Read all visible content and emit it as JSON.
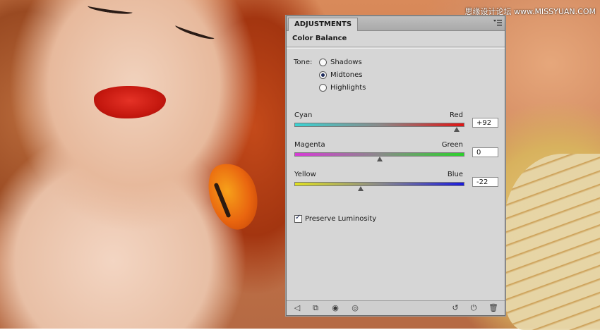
{
  "watermark": "思缘设计论坛 www.MISSYUAN.COM",
  "panel": {
    "tab_label": "ADJUSTMENTS",
    "heading": "Color Balance",
    "tone": {
      "label": "Tone:",
      "options": [
        {
          "label": "Shadows",
          "selected": false
        },
        {
          "label": "Midtones",
          "selected": true
        },
        {
          "label": "Highlights",
          "selected": false
        }
      ]
    },
    "sliders": [
      {
        "left_label": "Cyan",
        "right_label": "Red",
        "value": "+92",
        "numeric": 92,
        "track_colors": [
          "#3ad3d3",
          "#e01414"
        ]
      },
      {
        "left_label": "Magenta",
        "right_label": "Green",
        "value": "0",
        "numeric": 0,
        "track_colors": [
          "#d63ad6",
          "#2bd12b"
        ]
      },
      {
        "left_label": "Yellow",
        "right_label": "Blue",
        "value": "-22",
        "numeric": -22,
        "track_colors": [
          "#e0e020",
          "#1b1bdc"
        ]
      }
    ],
    "slider_range": [
      -100,
      100
    ],
    "preserve_luminosity": {
      "label": "Preserve Luminosity",
      "checked": true
    },
    "footer_icons": [
      "back-arrow-icon",
      "clip-to-layer-icon",
      "toggle-visibility-eye-icon",
      "view-previous-state-icon",
      "reset-icon",
      "power-toggle-icon",
      "trash-icon"
    ]
  }
}
